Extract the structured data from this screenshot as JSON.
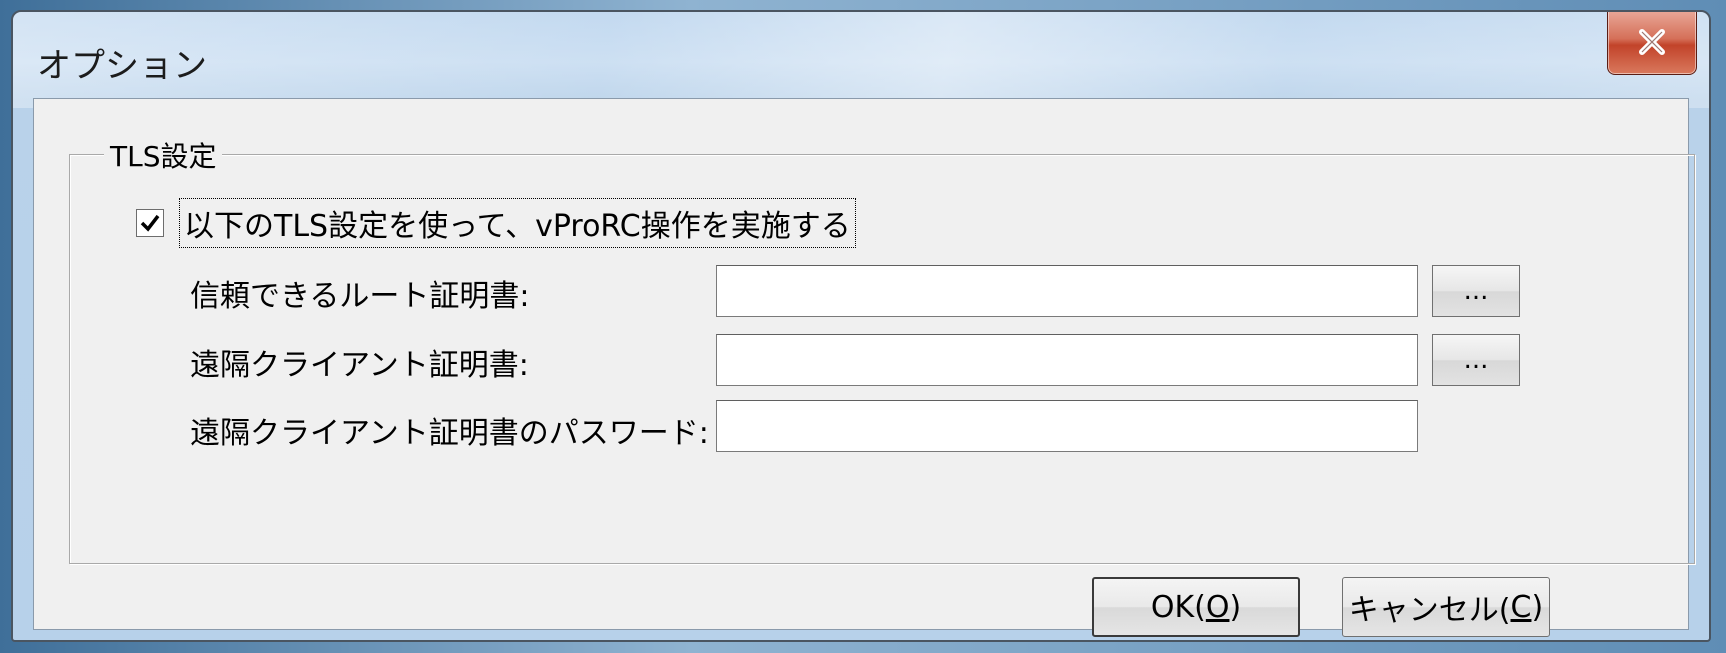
{
  "window": {
    "title": "オプション",
    "close_label": "x"
  },
  "group": {
    "legend": "TLS設定",
    "checkbox": {
      "checked": true,
      "label": "以下のTLS設定を使って、vProRC操作を実施する"
    },
    "rows": [
      {
        "label": "信頼できるルート証明書:",
        "value": "",
        "browse_label": "..."
      },
      {
        "label": "遠隔クライアント証明書:",
        "value": "",
        "browse_label": "..."
      },
      {
        "label": "遠隔クライアント証明書のパスワード:",
        "value": ""
      }
    ]
  },
  "buttons": {
    "ok": {
      "text": "OK(",
      "mnemonic": "O",
      "suffix": ")"
    },
    "cancel": {
      "text": "キャンセル(",
      "mnemonic": "C",
      "suffix": ")"
    }
  }
}
